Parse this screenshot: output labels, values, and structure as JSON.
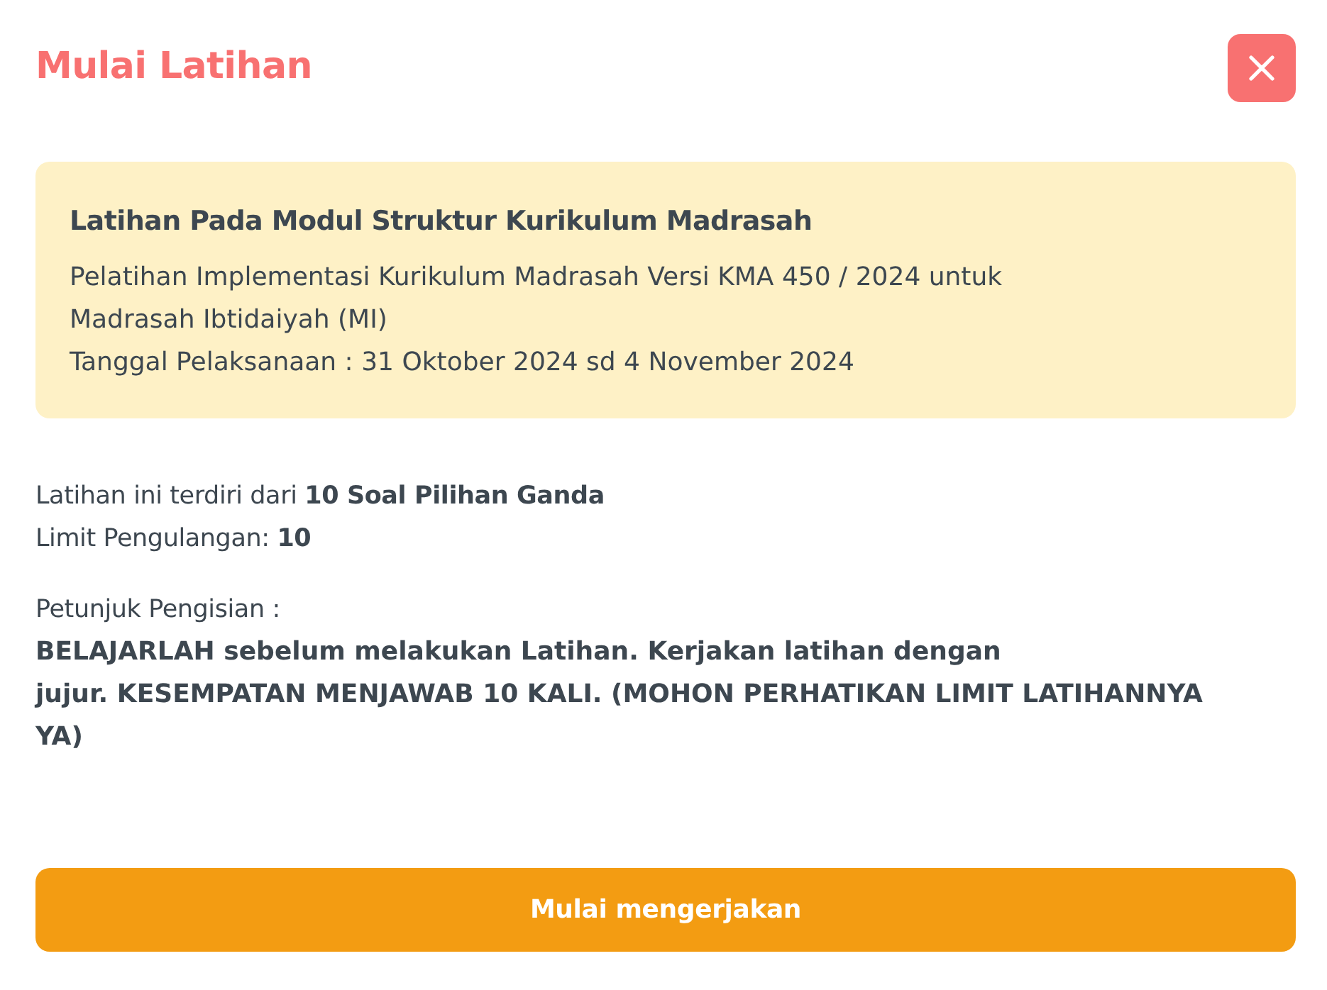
{
  "dialog": {
    "title": "Mulai Latihan"
  },
  "info_card": {
    "title": "Latihan Pada Modul Struktur Kurikulum Madrasah",
    "lines": [
      "Pelatihan Implementasi Kurikulum Madrasah Versi KMA 450 / 2024 untuk Madrasah Ibtidaiyah (MI)",
      "Tanggal Pelaksanaan : 31 Oktober 2024 sd 4 November 2024"
    ]
  },
  "summary": [
    "Latihan ini terdiri dari **10 Soal Pilihan Ganda**",
    "Limit Pengulangan: **10**"
  ],
  "instructions": {
    "label": "Petunjuk Pengisian :",
    "lines": [
      "BELAJARLAH sebelum melakukan Latihan. Kerjakan latihan dengan",
      "jujur. KESEMPATAN MENJAWAB 10 KALI. (MOHON PERHATIKAN LIMIT LATIHANNYA YA)"
    ]
  },
  "start_button": "Mulai mengerjakan"
}
